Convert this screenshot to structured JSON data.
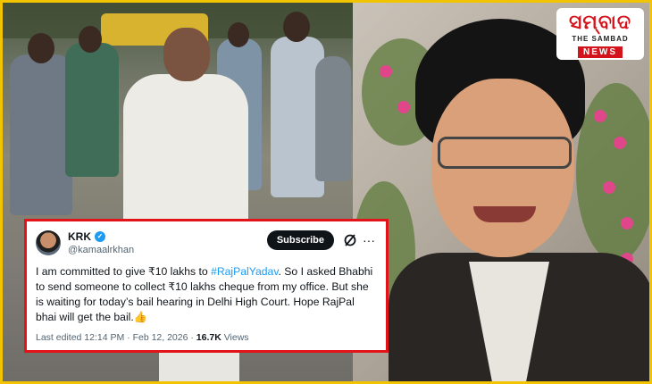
{
  "logo": {
    "main": "ସମ୍ବାଦ",
    "sub": "THE SAMBAD",
    "news": "NEWS"
  },
  "tweet": {
    "name": "KRK",
    "handle": "@kamaalrkhan",
    "subscribe_label": "Subscribe",
    "more_label": "···",
    "body_before": "I am committed to give ₹10 lakhs to ",
    "hashtag": "#RajPalYadav",
    "body_after": ". So I asked Bhabhi to send someone to collect ₹10 lakhs cheque from my office. But she is waiting for today’s bail hearing in Delhi High Court. Hope RajPal bhai will get the bail.👍",
    "edited": "Last edited 12:14 PM · Feb 12, 2026 · ",
    "views_count": "16.7K",
    "views_label": " Views"
  },
  "colors": {
    "frame_border": "#f2c400",
    "tweet_border": "#e3131a",
    "hashtag": "#1d9bf0",
    "verified": "#1d9bf0",
    "logo_red": "#d4141c"
  },
  "icons": [
    "verified-badge-icon",
    "grok-icon",
    "more-options-icon"
  ]
}
